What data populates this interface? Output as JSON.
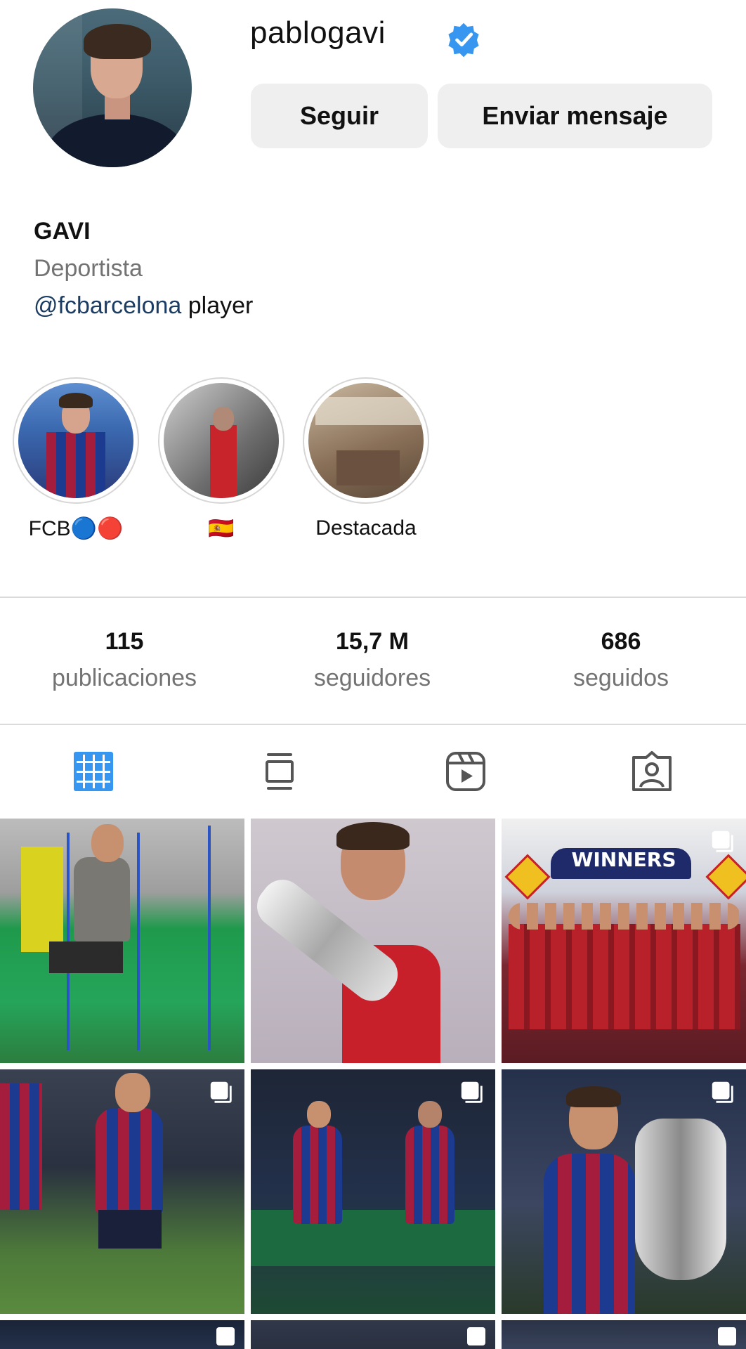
{
  "profile": {
    "username": "pablogavi",
    "follow_label": "Seguir",
    "message_label": "Enviar mensaje",
    "display_name": "GAVI",
    "category": "Deportista",
    "bio_mention": "@fcbarcelona",
    "bio_text": " player"
  },
  "highlights": [
    {
      "label": "FCB🔵🔴"
    },
    {
      "label": "🇪🇸"
    },
    {
      "label": "Destacada"
    }
  ],
  "stats": {
    "posts_count": "115",
    "posts_label": "publicaciones",
    "followers_count": "15,7 M",
    "followers_label": "seguidores",
    "following_count": "686",
    "following_label": "seguidos"
  },
  "tabs": [
    {
      "icon": "grid-icon",
      "active": true
    },
    {
      "icon": "guides-icon",
      "active": false
    },
    {
      "icon": "reels-icon",
      "active": false
    },
    {
      "icon": "tagged-icon",
      "active": false
    }
  ],
  "grid": {
    "posts": [
      {
        "multi": false
      },
      {
        "multi": false
      },
      {
        "multi": true,
        "banner": "WINNERS"
      },
      {
        "multi": true
      },
      {
        "multi": true
      },
      {
        "multi": true
      },
      {
        "multi": true
      },
      {
        "multi": true
      },
      {
        "multi": true
      }
    ]
  },
  "colors": {
    "accent": "#3797f0",
    "mention": "#1c3d63",
    "secondary_text": "#737373",
    "button_bg": "#efefef"
  }
}
